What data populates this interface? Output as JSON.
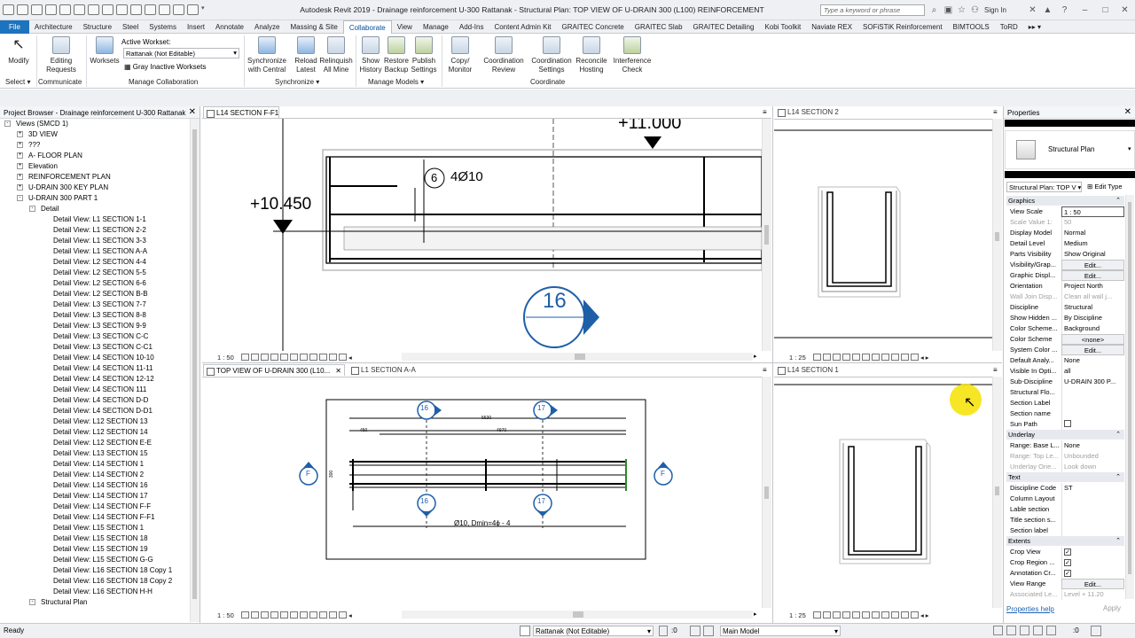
{
  "titlebar": {
    "title": "Autodesk Revit 2019 - Drainage reinforcement U-300 Rattanak - Structural Plan: TOP VIEW OF U-DRAIN 300 (L100) REINFORCEMENT",
    "search_placeholder": "Type a keyword or phrase",
    "sign_in": "Sign In"
  },
  "tabs": [
    "File",
    "Architecture",
    "Structure",
    "Steel",
    "Systems",
    "Insert",
    "Annotate",
    "Analyze",
    "Massing & Site",
    "Collaborate",
    "View",
    "Manage",
    "Add-Ins",
    "Content Admin Kit",
    "GRAITEC Concrete",
    "GRAITEC Slab",
    "GRAITEC Detailing",
    "Kobi Toolkit",
    "Naviate REX",
    "SOFiSTiK Reinforcement",
    "BIMTOOLS",
    "ToRD"
  ],
  "active_tab": "Collaborate",
  "ribbon": {
    "modify": "Modify",
    "editing_requests": [
      "Editing",
      "Requests"
    ],
    "worksets": "Worksets",
    "active_workset_label": "Active Workset:",
    "active_workset": "Rattanak (Not Editable)",
    "gray_inactive": "Gray Inactive Worksets",
    "sync_central": [
      "Synchronize",
      "with Central"
    ],
    "reload_latest": [
      "Reload",
      "Latest"
    ],
    "relinquish": [
      "Relinquish",
      "All Mine"
    ],
    "show_history": [
      "Show",
      "History"
    ],
    "restore_backup": [
      "Restore",
      "Backup"
    ],
    "publish_settings": [
      "Publish",
      "Settings"
    ],
    "copy_monitor": [
      "Copy/",
      "Monitor"
    ],
    "coord_review": [
      "Coordination",
      "Review"
    ],
    "coord_settings": [
      "Coordination",
      "Settings"
    ],
    "reconcile_hosting": [
      "Reconcile",
      "Hosting"
    ],
    "interference_check": [
      "Interference",
      "Check"
    ],
    "groups": {
      "select": "Select",
      "communicate": "Communicate",
      "manage_collab": "Manage Collaboration",
      "synchronize": "Synchronize",
      "manage_models": "Manage Models",
      "coordinate": "Coordinate"
    }
  },
  "project_browser": {
    "title": "Project Browser - Drainage reinforcement U-300 Rattanak",
    "items": [
      {
        "label": "Views (SMCD 1)",
        "level": 0,
        "exp": "-"
      },
      {
        "label": "3D VIEW",
        "level": 1,
        "exp": "+"
      },
      {
        "label": "???",
        "level": 1,
        "exp": "+"
      },
      {
        "label": "A- FLOOR PLAN",
        "level": 1,
        "exp": "+"
      },
      {
        "label": "Elevation",
        "level": 1,
        "exp": "+"
      },
      {
        "label": "REINFORCEMENT PLAN",
        "level": 1,
        "exp": "+"
      },
      {
        "label": "U-DRAIN 300 KEY PLAN",
        "level": 1,
        "exp": "+"
      },
      {
        "label": "U-DRAIN 300 PART 1",
        "level": 1,
        "exp": "-"
      },
      {
        "label": "Detail",
        "level": 2,
        "exp": "-"
      },
      {
        "label": "Detail View: L1 SECTION 1-1",
        "level": 3
      },
      {
        "label": "Detail View: L1 SECTION 2-2",
        "level": 3
      },
      {
        "label": "Detail View: L1 SECTION 3-3",
        "level": 3
      },
      {
        "label": "Detail View: L1 SECTION A-A",
        "level": 3
      },
      {
        "label": "Detail View: L2 SECTION 4-4",
        "level": 3
      },
      {
        "label": "Detail View: L2 SECTION 5-5",
        "level": 3
      },
      {
        "label": "Detail View: L2 SECTION 6-6",
        "level": 3
      },
      {
        "label": "Detail View: L2 SECTION B-B",
        "level": 3
      },
      {
        "label": "Detail View: L3 SECTION 7-7",
        "level": 3
      },
      {
        "label": "Detail View: L3 SECTION 8-8",
        "level": 3
      },
      {
        "label": "Detail View: L3 SECTION 9-9",
        "level": 3
      },
      {
        "label": "Detail View: L3 SECTION C-C",
        "level": 3
      },
      {
        "label": "Detail View: L3 SECTION C-C1",
        "level": 3
      },
      {
        "label": "Detail View: L4 SECTION 10-10",
        "level": 3
      },
      {
        "label": "Detail View: L4 SECTION 11-11",
        "level": 3
      },
      {
        "label": "Detail View: L4 SECTION 12-12",
        "level": 3
      },
      {
        "label": "Detail View: L4 SECTION 111",
        "level": 3
      },
      {
        "label": "Detail View: L4 SECTION D-D",
        "level": 3
      },
      {
        "label": "Detail View: L4 SECTION D-D1",
        "level": 3
      },
      {
        "label": "Detail View: L12 SECTION 13",
        "level": 3
      },
      {
        "label": "Detail View: L12 SECTION 14",
        "level": 3
      },
      {
        "label": "Detail View: L12 SECTION E-E",
        "level": 3
      },
      {
        "label": "Detail View: L13 SECTION 15",
        "level": 3
      },
      {
        "label": "Detail View: L14 SECTION 1",
        "level": 3
      },
      {
        "label": "Detail View: L14 SECTION 2",
        "level": 3
      },
      {
        "label": "Detail View: L14 SECTION 16",
        "level": 3
      },
      {
        "label": "Detail View: L14 SECTION 17",
        "level": 3
      },
      {
        "label": "Detail View: L14 SECTION F-F",
        "level": 3
      },
      {
        "label": "Detail View: L14 SECTION F-F1",
        "level": 3
      },
      {
        "label": "Detail View: L15 SECTION 1",
        "level": 3
      },
      {
        "label": "Detail View: L15 SECTION 18",
        "level": 3
      },
      {
        "label": "Detail View: L15 SECTION 19",
        "level": 3
      },
      {
        "label": "Detail View: L15 SECTION G-G",
        "level": 3
      },
      {
        "label": "Detail View: L16 SECTION 18 Copy 1",
        "level": 3
      },
      {
        "label": "Detail View: L16 SECTION 18 Copy 2",
        "level": 3
      },
      {
        "label": "Detail View: L16 SECTION H-H",
        "level": 3
      },
      {
        "label": "Structural Plan",
        "level": 2,
        "exp": "-"
      }
    ]
  },
  "views": {
    "v1": {
      "tab": "L14 SECTION F-F1",
      "scale": "1 : 50",
      "elev1": "+10.450",
      "elev2": "+11.000",
      "bar_no": "6",
      "bar_label": "4Ø10",
      "tag": "16"
    },
    "v2": {
      "tab": "L14 SECTION 2",
      "scale": "1 : 25"
    },
    "v3": {
      "tab_active": "TOP VIEW OF U-DRAIN 300 (L10...",
      "tab2": "L1 SECTION A-A",
      "scale": "1 : 50",
      "note": "Ø10, Dmin=4ϕ - 4",
      "tag16": "16",
      "tag17": "17",
      "tagF": "F",
      "dim1": "5530",
      "dim2": "450",
      "dim3": "4970",
      "dim_left": "300"
    },
    "v4": {
      "tab": "L14 SECTION 1",
      "scale": "1 : 25"
    }
  },
  "properties": {
    "title": "Properties",
    "type_name": "Structural Plan",
    "instance_filter": "Structural Plan: TOP V",
    "edit_type": "Edit Type",
    "rows": [
      {
        "cat": "Graphics"
      },
      {
        "k": "View Scale",
        "v": "1 : 50",
        "input": true
      },
      {
        "k": "Scale Value    1:",
        "v": "50",
        "dis": true
      },
      {
        "k": "Display Model",
        "v": "Normal"
      },
      {
        "k": "Detail Level",
        "v": "Medium"
      },
      {
        "k": "Parts Visibility",
        "v": "Show Original"
      },
      {
        "k": "Visibility/Grap...",
        "v": "Edit...",
        "btn": true
      },
      {
        "k": "Graphic Displ...",
        "v": "Edit...",
        "btn": true
      },
      {
        "k": "Orientation",
        "v": "Project North"
      },
      {
        "k": "Wall Join Disp...",
        "v": "Clean all wall j...",
        "dis": true
      },
      {
        "k": "Discipline",
        "v": "Structural"
      },
      {
        "k": "Show Hidden ...",
        "v": "By Discipline"
      },
      {
        "k": "Color Scheme...",
        "v": "Background"
      },
      {
        "k": "Color Scheme",
        "v": "<none>",
        "btn": true
      },
      {
        "k": "System Color ...",
        "v": "Edit...",
        "btn": true
      },
      {
        "k": "Default Analy...",
        "v": "None"
      },
      {
        "k": "Visible In Opti...",
        "v": "all"
      },
      {
        "k": "Sub-Discipline",
        "v": "U-DRAIN 300 P..."
      },
      {
        "k": "Structural Flo...",
        "v": ""
      },
      {
        "k": "Section Label",
        "v": ""
      },
      {
        "k": "Section name",
        "v": ""
      },
      {
        "k": "Sun Path",
        "v": "",
        "check": false
      },
      {
        "cat": "Underlay"
      },
      {
        "k": "Range: Base L...",
        "v": "None"
      },
      {
        "k": "Range: Top Le...",
        "v": "Unbounded",
        "dis": true
      },
      {
        "k": "Underlay Orie...",
        "v": "Look down",
        "dis": true
      },
      {
        "cat": "Text"
      },
      {
        "k": "Discipline Code",
        "v": "ST"
      },
      {
        "k": "Column Layout",
        "v": ""
      },
      {
        "k": "Lable section",
        "v": ""
      },
      {
        "k": "Title section s...",
        "v": ""
      },
      {
        "k": "Section label",
        "v": ""
      },
      {
        "cat": "Extents"
      },
      {
        "k": "Crop View",
        "v": "",
        "check": true
      },
      {
        "k": "Crop Region ...",
        "v": "",
        "check": true
      },
      {
        "k": "Annotation Cr...",
        "v": "",
        "check": true
      },
      {
        "k": "View Range",
        "v": "Edit...",
        "btn": true
      },
      {
        "k": "Associated Le...",
        "v": "Level + 11.20",
        "dis": true
      }
    ],
    "help": "Properties help",
    "apply": "Apply"
  },
  "status": {
    "ready": "Ready",
    "workset": "Rattanak (Not Editable)",
    "zero": ":0",
    "model": "Main Model",
    "filter_count": ":0"
  },
  "colors": {
    "tag_blue": "#1f5fa8",
    "file_tab": "#1e73be",
    "cursor": "#f4e200"
  }
}
